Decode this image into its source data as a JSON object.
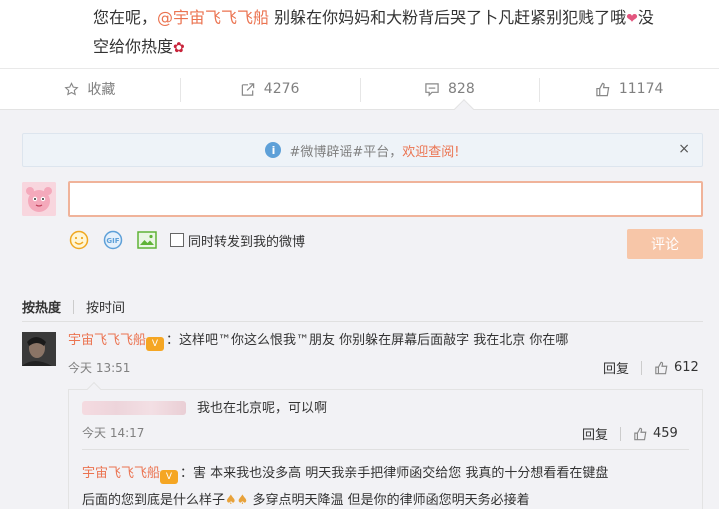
{
  "post": {
    "line1_prefix": "您在呢，",
    "mention": "@宇宙飞飞飞船",
    "line1_rest": " 别躲在你妈妈和大粉背后哭了卜凡赶紧别犯贱了哦",
    "line1_end": "没",
    "line2": "空给你热度"
  },
  "actions": [
    {
      "label": "收藏",
      "icon": "star-icon"
    },
    {
      "label": "4276",
      "icon": "share-icon"
    },
    {
      "label": "828",
      "icon": "comment-icon"
    },
    {
      "label": "11174",
      "icon": "like-icon"
    }
  ],
  "notice": {
    "text": "#微博辟谣#平台，",
    "link": "欢迎查阅!",
    "close": "×"
  },
  "composer": {
    "forward_label": "同时转发到我的微博",
    "submit_label": "评论"
  },
  "sort": {
    "hot": "按热度",
    "time": "按时间"
  },
  "comments": [
    {
      "user": "宇宙飞飞飞船",
      "text": "：这样吧™你这么恨我™朋友 你别躲在屏幕后面敲字 我在北京 你在哪",
      "time": "今天 13:51",
      "reply_label": "回复",
      "likes": "612",
      "replies": [
        {
          "text": "我也在北京呢，可以啊",
          "time": "今天 14:17",
          "reply_label": "回复",
          "likes": "459"
        },
        {
          "user": "宇宙飞飞飞船",
          "text_a": "：害 本来我也没多高 明天我亲手把律师函交给您 我真的十分想看看在键盘",
          "text_b": "后面的您到底是什么样子",
          "text_c": " 多穿点明天降温  但是你的律师函您明天务必接着"
        }
      ]
    }
  ]
}
